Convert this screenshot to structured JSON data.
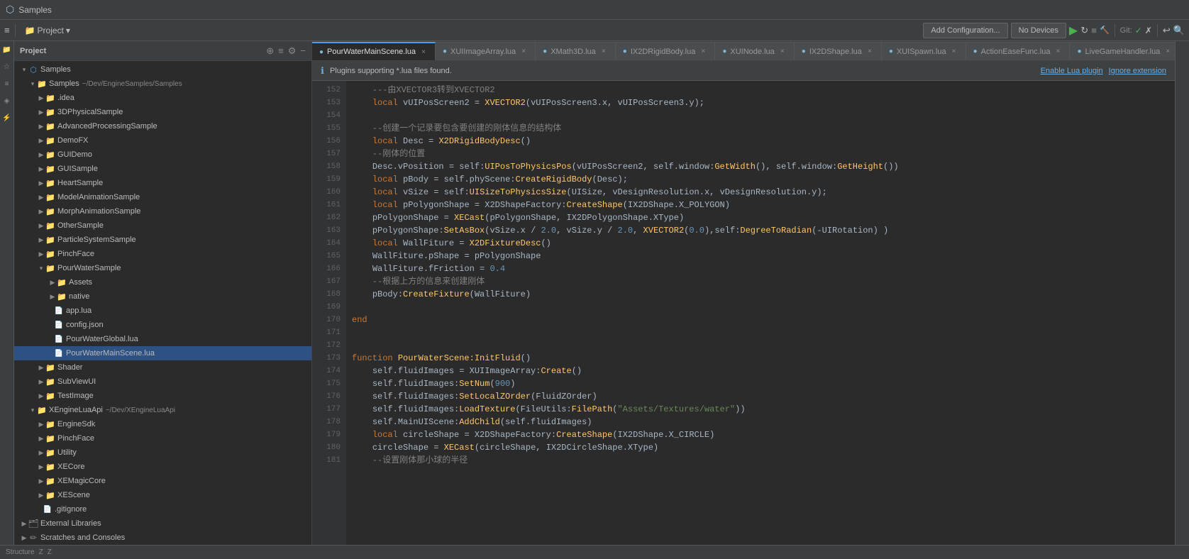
{
  "titlebar": {
    "title": "Samples"
  },
  "toolbar": {
    "project_label": "Project",
    "config_btn": "Add Configuration...",
    "devices_btn": "No Devices",
    "git_label": "Git:",
    "search_icon": "🔍"
  },
  "tabs": [
    {
      "id": "tab1",
      "label": "PourWaterMainScene.lua",
      "active": true
    },
    {
      "id": "tab2",
      "label": "XUIImageArray.lua",
      "active": false
    },
    {
      "id": "tab3",
      "label": "XMath3D.lua",
      "active": false
    },
    {
      "id": "tab4",
      "label": "IX2DRigidBody.lua",
      "active": false
    },
    {
      "id": "tab5",
      "label": "XUINode.lua",
      "active": false
    },
    {
      "id": "tab6",
      "label": "IX2DShape.lua",
      "active": false
    },
    {
      "id": "tab7",
      "label": "XUISpawn.lua",
      "active": false
    },
    {
      "id": "tab8",
      "label": "ActionEaseFunc.lua",
      "active": false
    },
    {
      "id": "tab9",
      "label": "LiveGameHandler.lua",
      "active": false
    }
  ],
  "notification": {
    "text": "Plugins supporting *.lua files found.",
    "enable_btn": "Enable Lua plugin",
    "ignore_btn": "Ignore extension"
  },
  "project_tree": {
    "header": "Project",
    "root": {
      "label": "Samples",
      "path": "~/Dev/EngineSamples/Samples",
      "children": [
        {
          "label": ".idea",
          "type": "folder",
          "expanded": false,
          "indent": 2
        },
        {
          "label": "3DPhysicalSample",
          "type": "folder",
          "expanded": false,
          "indent": 2
        },
        {
          "label": "AdvancedProcessingSample",
          "type": "folder",
          "expanded": false,
          "indent": 2
        },
        {
          "label": "DemoFX",
          "type": "folder",
          "expanded": false,
          "indent": 2
        },
        {
          "label": "GUIDemo",
          "type": "folder",
          "expanded": false,
          "indent": 2
        },
        {
          "label": "GUISample",
          "type": "folder",
          "expanded": false,
          "indent": 2
        },
        {
          "label": "HeartSample",
          "type": "folder",
          "expanded": false,
          "indent": 2
        },
        {
          "label": "ModelAnimationSample",
          "type": "folder",
          "expanded": false,
          "indent": 2
        },
        {
          "label": "MorphAnimationSample",
          "type": "folder",
          "expanded": false,
          "indent": 2
        },
        {
          "label": "OtherSample",
          "type": "folder",
          "expanded": false,
          "indent": 2,
          "selected": false
        },
        {
          "label": "ParticleSystemSample",
          "type": "folder",
          "expanded": false,
          "indent": 2
        },
        {
          "label": "PinchFace",
          "type": "folder",
          "expanded": false,
          "indent": 2
        },
        {
          "label": "PourWaterSample",
          "type": "folder",
          "expanded": true,
          "indent": 2
        },
        {
          "label": "Assets",
          "type": "folder",
          "expanded": false,
          "indent": 4
        },
        {
          "label": "native",
          "type": "folder",
          "expanded": false,
          "indent": 4
        },
        {
          "label": "app.lua",
          "type": "lua",
          "indent": 4
        },
        {
          "label": "config.json",
          "type": "json",
          "indent": 4
        },
        {
          "label": "PourWaterGlobal.lua",
          "type": "lua",
          "indent": 4
        },
        {
          "label": "PourWaterMainScene.lua",
          "type": "lua",
          "indent": 4,
          "selected": true
        },
        {
          "label": "Shader",
          "type": "folder",
          "expanded": false,
          "indent": 2
        },
        {
          "label": "SubViewUI",
          "type": "folder",
          "expanded": false,
          "indent": 2
        },
        {
          "label": "TestImage",
          "type": "folder",
          "expanded": false,
          "indent": 2
        }
      ]
    },
    "xengine_root": {
      "label": "XEngineLuaApi",
      "path": "~/Dev/XEngineLuaApi",
      "children": [
        {
          "label": "EngineSdk",
          "type": "folder",
          "indent": 2
        },
        {
          "label": "PinchFace",
          "type": "folder",
          "indent": 2
        },
        {
          "label": "Utility",
          "type": "folder",
          "indent": 2
        },
        {
          "label": "XECore",
          "type": "folder",
          "indent": 2
        },
        {
          "label": "XEMagicCore",
          "type": "folder",
          "indent": 2
        },
        {
          "label": "XEScene",
          "type": "folder",
          "indent": 2
        },
        {
          "label": ".gitignore",
          "type": "file",
          "indent": 2
        }
      ]
    },
    "external": {
      "label": "External Libraries"
    },
    "scratches": {
      "label": "Scratches and Consoles"
    }
  },
  "code_lines": [
    {
      "num": 152,
      "text": "    ---由XVECTOR3转到XVECTOR2",
      "type": "comment"
    },
    {
      "num": 153,
      "text": "    local vUIPosScreen2 = XVECTOR2(vUIPosScreen3.x, vUIPosScreen3.y);",
      "type": "code"
    },
    {
      "num": 154,
      "text": "",
      "type": "blank"
    },
    {
      "num": 155,
      "text": "    --创建一个记录要包含要创建的刚体信息的结构体",
      "type": "comment"
    },
    {
      "num": 156,
      "text": "    local Desc = X2DRigidBodyDesc()",
      "type": "code"
    },
    {
      "num": 157,
      "text": "    --刚体的位置",
      "type": "comment"
    },
    {
      "num": 158,
      "text": "    Desc.vPosition = self:UIPosToPhysicsPos(vUIPosScreen2, self.window:GetWidth(), self.window:GetHeight())",
      "type": "code"
    },
    {
      "num": 159,
      "text": "    local pBody = self.phyScene:CreateRigidBody(Desc);",
      "type": "code"
    },
    {
      "num": 160,
      "text": "    local vSize = self:UISizeToPhysicsSize(UISize, vDesignResolution.x, vDesignResolution.y);",
      "type": "code"
    },
    {
      "num": 161,
      "text": "    local pPolygonShape = X2DShapeFactory:CreateShape(IX2DShape.X_POLYGON)",
      "type": "code"
    },
    {
      "num": 162,
      "text": "    pPolygonShape = XECast(pPolygonShape, IX2DPolygonShape.XType)",
      "type": "code"
    },
    {
      "num": 163,
      "text": "    pPolygonShape:SetAsBox(vSize.x / 2.0, vSize.y / 2.0, XVECTOR2(0.0),self:DegreeToRadian(-UIRotation) )",
      "type": "code"
    },
    {
      "num": 164,
      "text": "    local WallFiture = X2DFixtureDesc()",
      "type": "code"
    },
    {
      "num": 165,
      "text": "    WallFiture.pShape = pPolygonShape",
      "type": "code"
    },
    {
      "num": 166,
      "text": "    WallFiture.fFriction = 0.4",
      "type": "code"
    },
    {
      "num": 167,
      "text": "    --根据上方的信息来创建刚体",
      "type": "comment"
    },
    {
      "num": 168,
      "text": "    pBody:CreateFixture(WallFiture)",
      "type": "code"
    },
    {
      "num": 169,
      "text": "",
      "type": "blank"
    },
    {
      "num": 170,
      "text": "end",
      "type": "keyword"
    },
    {
      "num": 171,
      "text": "",
      "type": "blank"
    },
    {
      "num": 172,
      "text": "",
      "type": "blank"
    },
    {
      "num": 173,
      "text": "function PourWaterScene:InitFluid()",
      "type": "function"
    },
    {
      "num": 174,
      "text": "    self.fluidImages = XUIImageArray:Create()",
      "type": "code"
    },
    {
      "num": 175,
      "text": "    self.fluidImages:SetNum(900)",
      "type": "code"
    },
    {
      "num": 176,
      "text": "    self.fluidImages:SetLocalZOrder(FluidZOrder)",
      "type": "code"
    },
    {
      "num": 177,
      "text": "    self.fluidImages:LoadTexture(FileUtils:FilePath(\"Assets/Textures/water\"))",
      "type": "code"
    },
    {
      "num": 178,
      "text": "    self.MainUIScene:AddChild(self.fluidImages)",
      "type": "code"
    },
    {
      "num": 179,
      "text": "    local circleShape = X2DShapeFactory:CreateShape(IX2DShape.X_CIRCLE)",
      "type": "code"
    },
    {
      "num": 180,
      "text": "    circleShape = XECast(circleShape, IX2DCircleShape.XType)",
      "type": "code"
    },
    {
      "num": 181,
      "text": "    --设置刚体那小球的半径",
      "type": "comment"
    }
  ]
}
